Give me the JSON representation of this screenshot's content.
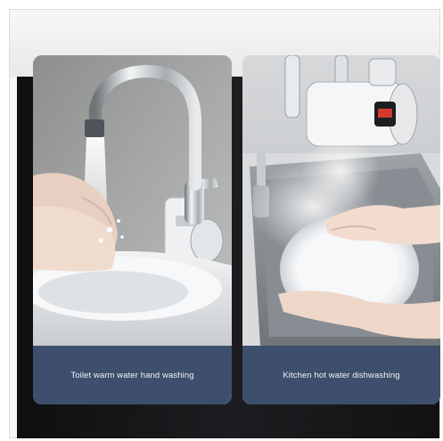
{
  "panels": [
    {
      "caption": "Toilet warm water hand washing",
      "scene": "bathroom-faucet-handwash"
    },
    {
      "caption": "Kitchen hot water dishwashing",
      "scene": "kitchen-faucet-dishwash"
    }
  ],
  "colors": {
    "caption_bar": "#3d4f6c",
    "caption_text": "#f2f4f8",
    "background_dark": "#141416",
    "background_light": "#f2f2f2"
  }
}
